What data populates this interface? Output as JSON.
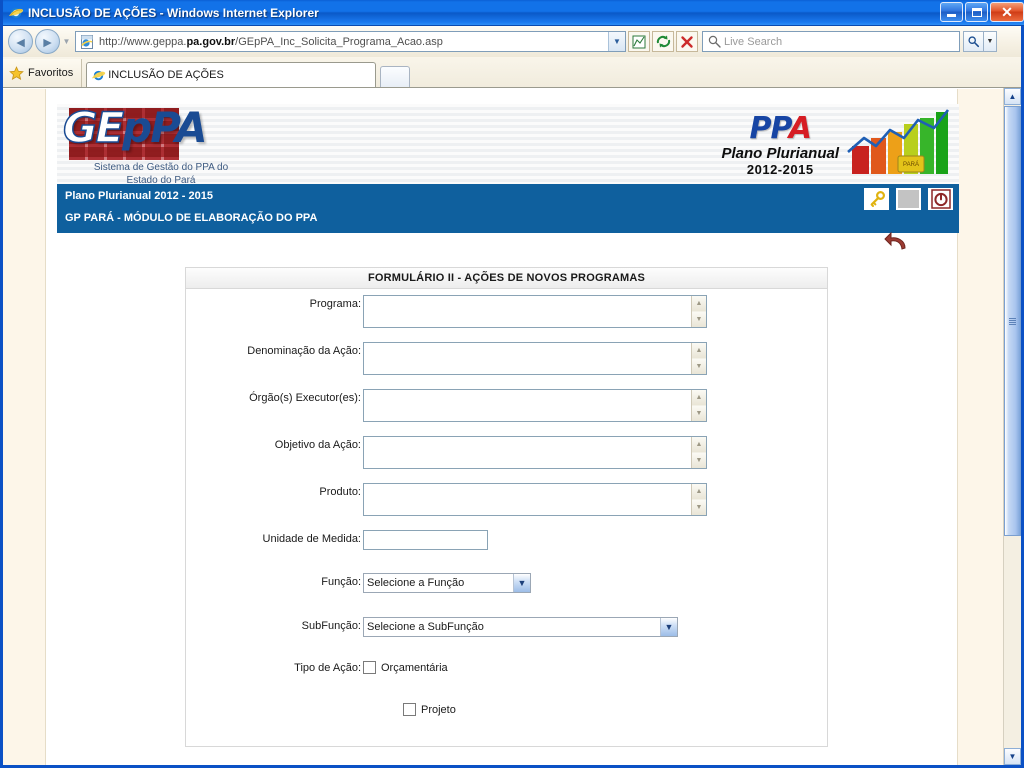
{
  "window": {
    "title": "INCLUSÃO DE AÇÕES - Windows Internet Explorer",
    "minimize_label": "Minimizar",
    "restore_label": "Restaurar",
    "close_label": "✕"
  },
  "browser": {
    "back_glyph": "◄",
    "forward_glyph": "►",
    "history_glyph": "▼",
    "address": {
      "url_prefix": "http://www.geppa.",
      "url_bold": "pa.gov.br",
      "url_suffix": "/GEpPA_Inc_Solicita_Programa_Acao.asp",
      "dropdown_glyph": "▼"
    },
    "toolbar_buttons": [
      {
        "name": "compatibility-view",
        "glyph": "▨"
      },
      {
        "name": "refresh",
        "glyph": "↻"
      },
      {
        "name": "stop",
        "glyph": "✕"
      }
    ],
    "search": {
      "placeholder": "Live Search",
      "go_glyph": "⌕",
      "dropdown_glyph": "▼"
    },
    "favorites_label": "Favoritos",
    "tab_label": "INCLUSÃO DE AÇÕES",
    "new_tab_label": ""
  },
  "page": {
    "logo": {
      "part1": "GE",
      "part2": "p",
      "part3": "PA",
      "subtitle_line1": "Sistema de Gestão do PPA do",
      "subtitle_line2": "Estado do Pará"
    },
    "ppa_brand": {
      "word_p1": "PP",
      "word_a": "A",
      "line1": "Plano Plurianual",
      "line2": "2012-2015"
    },
    "module_bar": {
      "line1": "Plano Plurianual 2012 - 2015",
      "line2": "GP PARÁ - MÓDULO DE ELABORAÇÃO DO PPA",
      "icons": [
        {
          "name": "key-icon",
          "glyph": "🔑"
        },
        {
          "name": "window-icon",
          "glyph": ""
        },
        {
          "name": "power-exit-icon",
          "glyph": "⏻"
        }
      ]
    },
    "back_arrow_name": "back-arrow-icon",
    "form": {
      "header": "FORMULÁRIO II - AÇÕES DE NOVOS PROGRAMAS",
      "fields": [
        {
          "label": "Programa:",
          "type": "textarea",
          "value": ""
        },
        {
          "label": "Denominação da Ação:",
          "type": "textarea",
          "value": ""
        },
        {
          "label": "Órgão(s) Executor(es):",
          "type": "textarea",
          "value": ""
        },
        {
          "label": "Objetivo da Ação:",
          "type": "textarea",
          "value": ""
        },
        {
          "label": "Produto:",
          "type": "textarea",
          "value": ""
        },
        {
          "label": "Unidade de Medida:",
          "type": "input",
          "value": ""
        },
        {
          "label": "Função:",
          "type": "select",
          "value": "Selecione a Função"
        },
        {
          "label": "SubFunção:",
          "type": "select",
          "value": "Selecione a SubFunção"
        },
        {
          "label": "Tipo de Ação:",
          "type": "checkbox",
          "value": "Orçamentária"
        },
        {
          "label": "",
          "type": "checkbox",
          "value": "Projeto"
        }
      ],
      "select_arrow_glyph": "▼",
      "textarea_up_glyph": "▲",
      "textarea_down_glyph": "▼"
    }
  },
  "scrollbar": {
    "up_glyph": "▲",
    "down_glyph": "▼"
  },
  "colors": {
    "titlebar_blue": "#1272e8",
    "module_blue": "#0f609e",
    "page_cream": "#fdf6e9",
    "logo_blue": "#1a4b93",
    "brand_red": "#d61d24"
  }
}
